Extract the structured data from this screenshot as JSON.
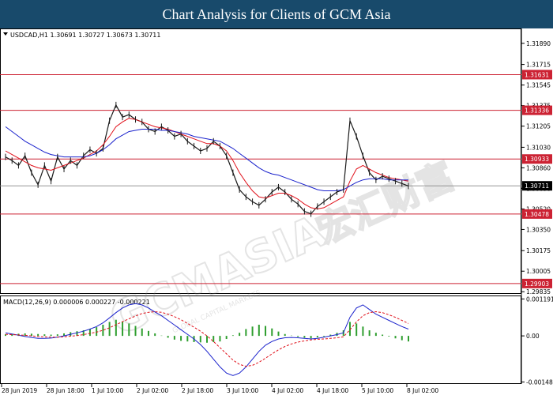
{
  "header": {
    "title": "Chart Analysis for Clients of GCM Asia"
  },
  "watermark": {
    "text": "GCMASIA",
    "chinese": "宏汇财富",
    "subtext": "GLOBAL CAPITAL MARKETS"
  },
  "colors": {
    "header_bg": "#184a6b",
    "price_line": "#1a1a1a",
    "ma_fast": "#e0101a",
    "ma_slow": "#1a22cc",
    "level_line": "#cc2233",
    "level_label_bg": "#cc2233",
    "current_label_bg": "#000000",
    "macd_hist": "#2e9e2e",
    "macd_line": "#1a22cc",
    "signal_line": "#e0101a"
  },
  "chart_data": [
    {
      "type": "line",
      "symbol_info": "USDCAD,H1  1.30691 1.30727 1.30673 1.30711",
      "x_tick_labels": [
        "28 Jun 2019",
        "28 Jun 18:00",
        "1 Jul 10:00",
        "2 Jul 02:00",
        "2 Jul 18:00",
        "3 Jul 10:00",
        "4 Jul 02:00",
        "4 Jul 18:00",
        "5 Jul 10:00",
        "8 Jul 02:00"
      ],
      "y_tick_labels": [
        "1.31890",
        "1.31715",
        "1.31545",
        "1.31375",
        "1.31205",
        "1.31030",
        "1.30860",
        "1.30690",
        "1.30520",
        "1.30350",
        "1.30175",
        "1.30005",
        "1.29835"
      ],
      "ylim": [
        1.2983,
        1.32
      ],
      "levels": [
        {
          "value": 1.31631,
          "label": "1.31631"
        },
        {
          "value": 1.31336,
          "label": "1.31336"
        },
        {
          "value": 1.30933,
          "label": "1.30933"
        },
        {
          "value": 1.30478,
          "label": "1.30478"
        },
        {
          "value": 1.29903,
          "label": "1.29903"
        }
      ],
      "current_price": {
        "value": 1.30711,
        "label": "1.30711"
      },
      "series": [
        {
          "name": "Price",
          "values": [
            1.3095,
            1.3092,
            1.3088,
            1.3096,
            1.3082,
            1.3072,
            1.3088,
            1.3075,
            1.3095,
            1.3085,
            1.3092,
            1.3088,
            1.3096,
            1.3101,
            1.3098,
            1.3102,
            1.3125,
            1.3138,
            1.3128,
            1.313,
            1.3126,
            1.3124,
            1.3118,
            1.3116,
            1.312,
            1.3117,
            1.3112,
            1.3114,
            1.3108,
            1.3104,
            1.31,
            1.3102,
            1.3108,
            1.3104,
            1.3096,
            1.3082,
            1.3068,
            1.3062,
            1.3058,
            1.3055,
            1.306,
            1.3066,
            1.307,
            1.3066,
            1.306,
            1.3056,
            1.305,
            1.3048,
            1.3054,
            1.3058,
            1.3062,
            1.3066,
            1.3068,
            1.3125,
            1.3112,
            1.3096,
            1.3082,
            1.3076,
            1.3079,
            1.3077,
            1.3075,
            1.3073,
            1.3071
          ]
        },
        {
          "name": "MA fast",
          "values": [
            1.31,
            1.3097,
            1.3094,
            1.3091,
            1.3088,
            1.3086,
            1.3085,
            1.3084,
            1.3086,
            1.3088,
            1.309,
            1.3092,
            1.3094,
            1.3097,
            1.31,
            1.3105,
            1.3112,
            1.312,
            1.3124,
            1.3127,
            1.3126,
            1.3124,
            1.3122,
            1.312,
            1.3119,
            1.3118,
            1.3116,
            1.3114,
            1.3112,
            1.311,
            1.3108,
            1.3106,
            1.3106,
            1.3104,
            1.31,
            1.3092,
            1.3082,
            1.3074,
            1.3067,
            1.3062,
            1.3061,
            1.3063,
            1.3065,
            1.3065,
            1.3063,
            1.306,
            1.3056,
            1.3053,
            1.3052,
            1.3053,
            1.3056,
            1.3059,
            1.3062,
            1.3075,
            1.3085,
            1.3088,
            1.3085,
            1.3082,
            1.308,
            1.3078,
            1.3077,
            1.3076,
            1.3075
          ]
        },
        {
          "name": "MA slow",
          "values": [
            1.312,
            1.3116,
            1.3112,
            1.3108,
            1.3105,
            1.3102,
            1.3099,
            1.3097,
            1.3096,
            1.3095,
            1.3095,
            1.3095,
            1.3095,
            1.3096,
            1.3098,
            1.3101,
            1.3105,
            1.311,
            1.3113,
            1.3116,
            1.3117,
            1.3118,
            1.3118,
            1.3118,
            1.3117,
            1.3117,
            1.3116,
            1.3115,
            1.3114,
            1.3112,
            1.3111,
            1.311,
            1.3109,
            1.3108,
            1.3105,
            1.3102,
            1.3098,
            1.3094,
            1.309,
            1.3086,
            1.3083,
            1.3081,
            1.308,
            1.3078,
            1.3076,
            1.3074,
            1.3072,
            1.307,
            1.3068,
            1.3067,
            1.3067,
            1.3067,
            1.3068,
            1.3071,
            1.3074,
            1.3076,
            1.3077,
            1.3077,
            1.3077,
            1.3076,
            1.3076,
            1.3076,
            1.3076
          ]
        }
      ]
    },
    {
      "type": "bar",
      "indicator_info": "MACD(12,26,9) 0.000006 0.000227 -0.000221",
      "y_tick_labels": [
        "0.001191",
        "0.00",
        "-0.001486"
      ],
      "ylim": [
        -0.0015,
        0.0012
      ],
      "series": [
        {
          "name": "Histogram",
          "values": [
            5e-05,
            6e-05,
            7e-05,
            8e-05,
            7e-05,
            6e-05,
            5e-05,
            4e-05,
            5e-05,
            8e-05,
            0.00012,
            0.00015,
            0.00018,
            0.00022,
            0.00028,
            0.00036,
            0.00045,
            0.00052,
            0.00046,
            0.0004,
            0.00032,
            0.00024,
            0.00016,
            8e-05,
            1e-05,
            -6e-05,
            -0.00012,
            -0.00016,
            -0.00018,
            -0.0002,
            -0.00021,
            -0.00022,
            -0.0002,
            -0.00018,
            -0.0001,
            2e-05,
            0.0001,
            0.00022,
            0.0003,
            0.00036,
            0.00032,
            0.00024,
            0.00014,
            6e-05,
            1e-05,
            -3e-05,
            -6e-05,
            -8e-05,
            -5e-05,
            -2e-05,
            4e-05,
            0.0001,
            0.00018,
            0.00045,
            0.0004,
            0.0003,
            0.00018,
            0.0001,
            4e-05,
            -2e-05,
            -8e-05,
            -0.00014,
            -0.00018
          ]
        },
        {
          "name": "MACD",
          "values": [
            0.0001,
            6e-05,
            2e-05,
            -2e-05,
            -5e-05,
            -8e-05,
            -8e-05,
            -7e-05,
            -4e-05,
            0.0,
            5e-05,
            0.0001,
            0.00015,
            0.00022,
            0.0003,
            0.00042,
            0.00058,
            0.00075,
            0.0009,
            0.001,
            0.00104,
            0.001,
            0.0009,
            0.00077,
            0.00065,
            0.0005,
            0.00035,
            0.0002,
            5e-05,
            -0.0001,
            -0.00028,
            -0.0005,
            -0.00075,
            -0.001,
            -0.0012,
            -0.00128,
            -0.0012,
            -0.001,
            -0.00075,
            -0.0005,
            -0.0003,
            -0.00018,
            -0.0001,
            -6e-05,
            -5e-05,
            -6e-05,
            -8e-05,
            -0.0001,
            -8e-05,
            -4e-05,
            0.0,
            4e-05,
            0.0001,
            0.0006,
            0.0009,
            0.001,
            0.00085,
            0.0007,
            0.0006,
            0.0005,
            0.0004,
            0.0003,
            0.00022
          ]
        },
        {
          "name": "Signal",
          "values": [
            5e-05,
            4e-05,
            3e-05,
            2e-05,
            0.0,
            -2e-05,
            -3e-05,
            -4e-05,
            -4e-05,
            -3e-05,
            -1e-05,
            1e-05,
            4e-05,
            8e-05,
            0.00012,
            0.00018,
            0.00026,
            0.00036,
            0.00046,
            0.00055,
            0.00064,
            0.00072,
            0.00076,
            0.00078,
            0.00076,
            0.0007,
            0.00062,
            0.00052,
            0.0004,
            0.00028,
            0.00015,
            0.0,
            -0.00018,
            -0.00038,
            -0.00058,
            -0.00078,
            -0.00092,
            -0.00098,
            -0.00095,
            -0.00085,
            -0.00072,
            -0.00058,
            -0.00045,
            -0.00034,
            -0.00026,
            -0.0002,
            -0.00016,
            -0.00013,
            -0.00011,
            -0.0001,
            -8e-05,
            -6e-05,
            -3e-05,
            0.0002,
            0.00045,
            0.00065,
            0.00075,
            0.00078,
            0.00075,
            0.00068,
            0.0006,
            0.0005,
            0.0004
          ]
        }
      ]
    }
  ]
}
